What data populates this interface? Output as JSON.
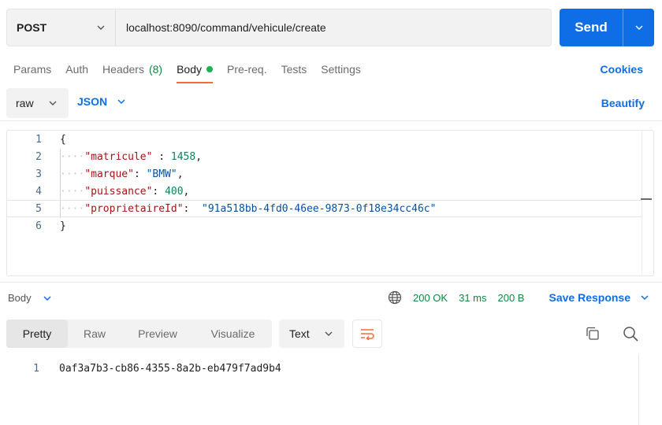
{
  "request": {
    "method": "POST",
    "url": "localhost:8090/command/vehicule/create",
    "send_label": "Send"
  },
  "tabs": [
    {
      "label": "Params"
    },
    {
      "label": "Auth"
    },
    {
      "label": "Headers",
      "count": "(8)"
    },
    {
      "label": "Body",
      "active": true
    },
    {
      "label": "Pre-req."
    },
    {
      "label": "Tests"
    },
    {
      "label": "Settings"
    }
  ],
  "cookies_label": "Cookies",
  "body_mode": {
    "raw_label": "raw",
    "format_label": "JSON",
    "beautify_label": "Beautify"
  },
  "editor": {
    "lines": [
      {
        "n": "1",
        "brace": "{"
      },
      {
        "n": "2",
        "key": "\"matricule\"",
        "sep": " : ",
        "value": "1458",
        "vtype": "number",
        "trail": ","
      },
      {
        "n": "3",
        "key": "\"marque\"",
        "sep": ": ",
        "value": "\"BMW\"",
        "vtype": "string",
        "trail": ","
      },
      {
        "n": "4",
        "key": "\"puissance\"",
        "sep": ": ",
        "value": "400",
        "vtype": "number",
        "trail": ","
      },
      {
        "n": "5",
        "key": "\"proprietaireId\"",
        "sep": ":  ",
        "value": "\"91a518bb-4fd0-46ee-9873-0f18e34cc46c\"",
        "vtype": "string",
        "trail": ""
      },
      {
        "n": "6",
        "brace": "}"
      }
    ]
  },
  "response": {
    "body_label": "Body",
    "status": "200 OK",
    "time": "31 ms",
    "size": "200 B",
    "save_label": "Save Response",
    "view_tabs": [
      {
        "label": "Pretty",
        "active": true
      },
      {
        "label": "Raw"
      },
      {
        "label": "Preview"
      },
      {
        "label": "Visualize"
      }
    ],
    "format_label": "Text",
    "line_number": "1",
    "content": "0af3a7b3-cb86-4355-8a2b-eb479f7ad9b4"
  },
  "colors": {
    "accent": "#0f6ee6",
    "active_tab_underline": "#f26b3a",
    "success": "#0b8a3e",
    "body_dot": "#1cb254"
  },
  "icons": [
    "chevron-down-icon",
    "globe-icon",
    "wrap-lines-icon",
    "copy-icon",
    "search-icon"
  ]
}
